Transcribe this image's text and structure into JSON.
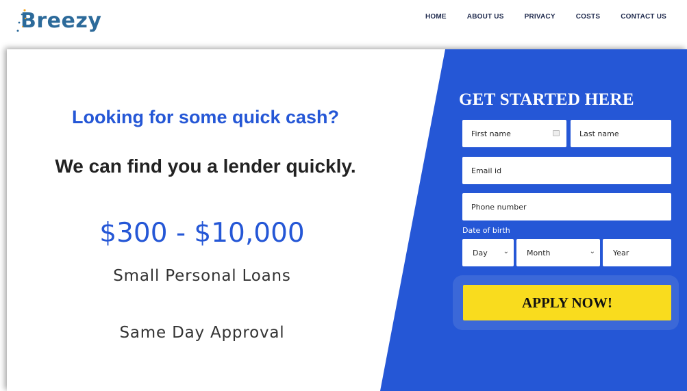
{
  "header": {
    "logo_text": "Breezy",
    "nav": [
      "HOME",
      "ABOUT US",
      "PRIVACY",
      "COSTS",
      "CONTACT US"
    ]
  },
  "hero": {
    "question": "Looking for some quick cash?",
    "lender_line": "We can find you a lender quickly.",
    "amount_range": "$300 - $10,000",
    "loan_type": "Small Personal Loans",
    "approval": "Same Day Approval"
  },
  "form": {
    "title": "GET STARTED HERE",
    "first_name_placeholder": "First name",
    "last_name_placeholder": "Last name",
    "email_placeholder": "Email id",
    "phone_placeholder": "Phone number",
    "dob_label": "Date of birth",
    "day_value": "Day",
    "month_value": "Month",
    "year_placeholder": "Year",
    "apply_label": "APPLY NOW!"
  },
  "colors": {
    "brand_blue": "#2557d6",
    "logo_blue": "#2c6a9a",
    "button_yellow": "#f9dc1e"
  },
  "icons": {
    "logo_decoration": "dots-icon",
    "first_name_field": "contact-card-icon",
    "select_arrow": "chevron-down-icon"
  }
}
